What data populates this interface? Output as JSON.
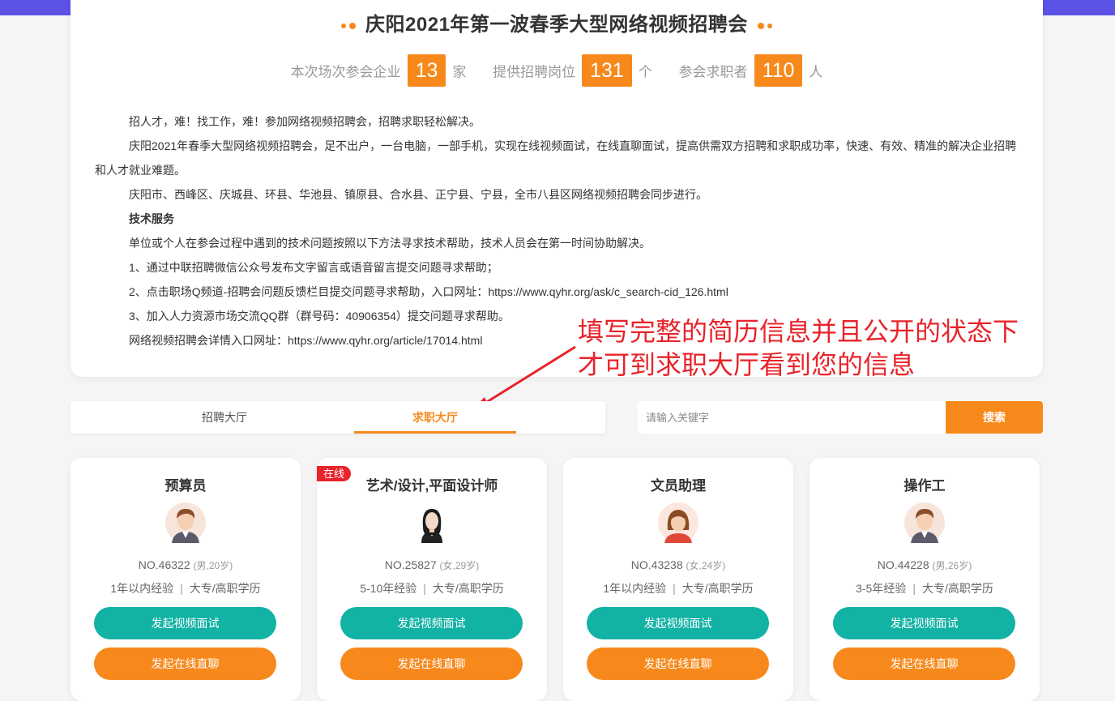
{
  "fair": {
    "title": "庆阳2021年第一波春季大型网络视频招聘会",
    "stats": [
      {
        "label": "本次场次参会企业",
        "value": "13",
        "unit": "家"
      },
      {
        "label": "提供招聘岗位",
        "value": "131",
        "unit": "个"
      },
      {
        "label": "参会求职者",
        "value": "110",
        "unit": "人"
      }
    ],
    "paragraphs": [
      "招人才，难！找工作，难！参加网络视频招聘会，招聘求职轻松解决。",
      "庆阳2021年春季大型网络视频招聘会，足不出户，一台电脑，一部手机，实现在线视频面试，在线直聊面试，提高供需双方招聘和求职成功率，快速、有效、精准的解决企业招聘和人才就业难题。",
      "庆阳市、西峰区、庆城县、环县、华池县、镇原县、合水县、正宁县、宁县，全市八县区网络视频招聘会同步进行。",
      "技术服务",
      "单位或个人在参会过程中遇到的技术问题按照以下方法寻求技术帮助，技术人员会在第一时间协助解决。",
      "1、通过中联招聘微信公众号发布文字留言或语音留言提交问题寻求帮助；",
      "2、点击职场Q频道-招聘会问题反馈栏目提交问题寻求帮助，入口网址：https://www.qyhr.org/ask/c_search-cid_126.html",
      "3、加入人力资源市场交流QQ群（群号码：40906354）提交问题寻求帮助。",
      "网络视频招聘会详情入口网址：https://www.qyhr.org/article/17014.html"
    ]
  },
  "annotation": "填写完整的简历信息并且公开的状态下才可到求职大厅看到您的信息",
  "tabs": [
    {
      "label": "招聘大厅"
    },
    {
      "label": "求职大厅",
      "active": true
    }
  ],
  "search": {
    "placeholder": "请输入关键字",
    "button": "搜索"
  },
  "colors": {
    "accent": "#f7891c",
    "teal": "#12b2a4",
    "red": "#e8232a",
    "band": "#5b52e6"
  },
  "candidates": [
    {
      "title": "预算员",
      "online": false,
      "no": "NO.46322",
      "meta": "(男,20岁)",
      "experience": "1年以内经验",
      "education": "大专/高职学历",
      "avatar": "male-avatar-icon",
      "video_btn": "发起视频面试",
      "chat_btn": "发起在线直聊"
    },
    {
      "title": "艺术/设计,平面设计师",
      "online": true,
      "online_label": "在线",
      "no": "NO.25827",
      "meta": "(女,29岁)",
      "experience": "5-10年经验",
      "education": "大专/高职学历",
      "avatar": "photo-avatar-icon",
      "video_btn": "发起视频面试",
      "chat_btn": "发起在线直聊"
    },
    {
      "title": "文员助理",
      "online": false,
      "no": "NO.43238",
      "meta": "(女,24岁)",
      "experience": "1年以内经验",
      "education": "大专/高职学历",
      "avatar": "female-avatar-icon",
      "video_btn": "发起视频面试",
      "chat_btn": "发起在线直聊"
    },
    {
      "title": "操作工",
      "online": false,
      "no": "NO.44228",
      "meta": "(男,26岁)",
      "experience": "3-5年经验",
      "education": "大专/高职学历",
      "avatar": "male-avatar-icon",
      "video_btn": "发起视频面试",
      "chat_btn": "发起在线直聊"
    }
  ]
}
